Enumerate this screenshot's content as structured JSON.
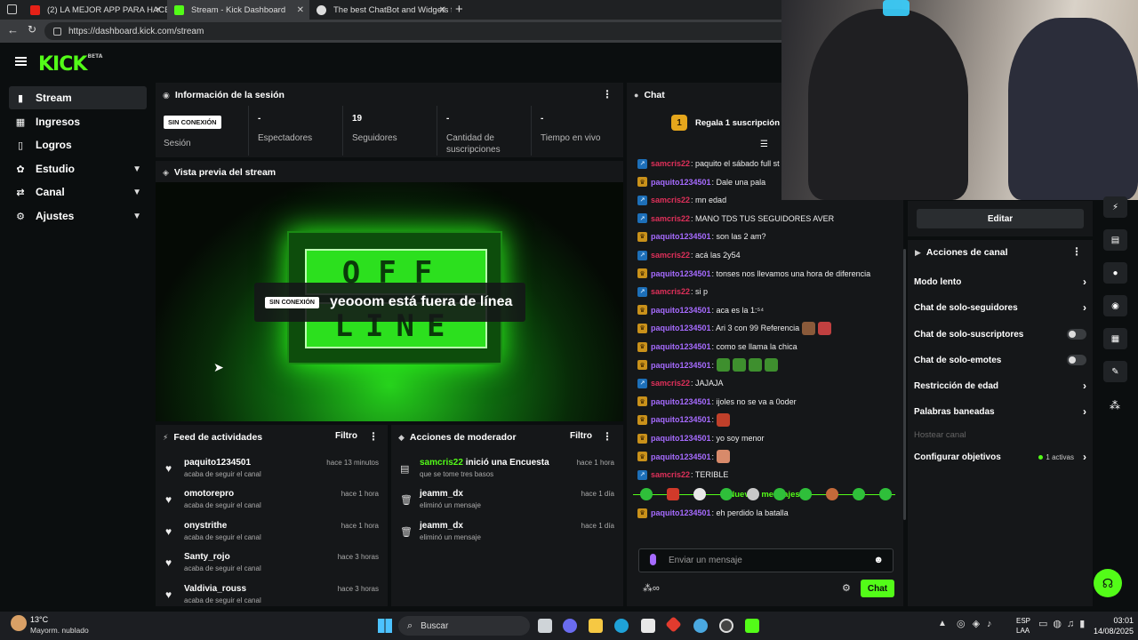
{
  "browser": {
    "tabs": [
      {
        "title": "(2) LA MEJOR APP PARA HACER I",
        "icon": "youtube-icon"
      },
      {
        "title": "Stream - Kick Dashboard",
        "icon": "kick-icon"
      },
      {
        "title": "The best ChatBot and Widgets fo",
        "icon": "botrix-icon"
      }
    ],
    "url": "https://dashboard.kick.com/stream"
  },
  "brand": {
    "logo": "KICK",
    "beta": "BETA",
    "accent": "#53fc18"
  },
  "sidebar": {
    "items": [
      {
        "label": "Stream",
        "icon": "stream-icon"
      },
      {
        "label": "Ingresos",
        "icon": "chart-icon"
      },
      {
        "label": "Logros",
        "icon": "trophy-icon"
      },
      {
        "label": "Estudio",
        "icon": "palette-icon"
      },
      {
        "label": "Canal",
        "icon": "channel-icon"
      },
      {
        "label": "Ajustes",
        "icon": "gear-icon"
      }
    ]
  },
  "session": {
    "title": "Información de la sesión",
    "badge": "SIN CONEXIÓN",
    "session_label": "Sesión",
    "stats": [
      {
        "value": "-",
        "label": "Espectadores"
      },
      {
        "value": "19",
        "label": "Seguidores"
      },
      {
        "value": "-",
        "label": "Cantidad de suscripciones"
      },
      {
        "value": "-",
        "label": "Tiempo en vivo"
      }
    ]
  },
  "preview": {
    "title": "Vista previa del stream",
    "badge": "SIN CONEXIÓN",
    "message": "yeooom está fuera de línea",
    "sign_top": "OFF",
    "sign_bottom": "LINE"
  },
  "feed": {
    "title": "Feed de actividades",
    "filter": "Filtro",
    "items": [
      {
        "name": "paquito1234501",
        "sub": "acaba de seguir el canal",
        "time": "hace 13 minutos"
      },
      {
        "name": "omotorepro",
        "sub": "acaba de seguir el canal",
        "time": "hace 1 hora"
      },
      {
        "name": "onystrithe",
        "sub": "acaba de seguir el canal",
        "time": "hace 1 hora"
      },
      {
        "name": "Santy_rojo",
        "sub": "acaba de seguir el canal",
        "time": "hace 3 horas"
      },
      {
        "name": "Valdivia_rouss",
        "sub": "acaba de seguir el canal",
        "time": "hace 3 horas"
      }
    ]
  },
  "mod": {
    "title": "Acciones de moderador",
    "filter": "Filtro",
    "items": [
      {
        "user": "samcris22",
        "action": " inició una Encuesta",
        "sub": "que se tome tres basos",
        "time": "hace 1 hora",
        "icon": "poll-icon"
      },
      {
        "user": "jeamm_dx",
        "action": "",
        "sub": "eliminó un mensaje",
        "time": "hace 1 día",
        "icon": "trash-icon"
      },
      {
        "user": "jeamm_dx",
        "action": "",
        "sub": "eliminó un mensaje",
        "time": "hace 1 día",
        "icon": "trash-icon"
      }
    ]
  },
  "chat": {
    "title": "Chat",
    "pinned": "Regala 1 suscripción pa",
    "pinned_num": "1",
    "new_messages": "Nuevos mensajes",
    "placeholder": "Enviar un mensaje",
    "send": "Chat",
    "messages": [
      {
        "user": "samcris22",
        "text": ": paquito el sábado full st",
        "badge": "blue"
      },
      {
        "user": "paquito1234501",
        "text": ": Dale una pala",
        "badge": "gold"
      },
      {
        "user": "samcris22",
        "text": ": mn edad",
        "badge": "blue"
      },
      {
        "user": "samcris22",
        "text": ": MANO TDS TUS SEGUIDORES AVER",
        "badge": "blue"
      },
      {
        "user": "paquito1234501",
        "text": ": son las 2 am?",
        "badge": "gold"
      },
      {
        "user": "samcris22",
        "text": ": acá las 2y54",
        "badge": "blue"
      },
      {
        "user": "paquito1234501",
        "text": ": tonses nos llevamos una hora de diferencia",
        "badge": "gold"
      },
      {
        "user": "samcris22",
        "text": ": si p",
        "badge": "blue"
      },
      {
        "user": "paquito1234501",
        "text": ": aca es la 1:⁵⁴",
        "badge": "gold"
      },
      {
        "user": "paquito1234501",
        "text": ": Ari 3 con 99 Referencia",
        "badge": "gold"
      },
      {
        "user": "paquito1234501",
        "text": ": como se llama la chica",
        "badge": "gold"
      },
      {
        "user": "paquito1234501",
        "text": ":",
        "badge": "gold"
      },
      {
        "user": "samcris22",
        "text": ": JAJAJA",
        "badge": "blue"
      },
      {
        "user": "paquito1234501",
        "text": ": ijoles no se va a 0oder",
        "badge": "gold"
      },
      {
        "user": "paquito1234501",
        "text": ":",
        "badge": "gold"
      },
      {
        "user": "paquito1234501",
        "text": ": yo soy menor",
        "badge": "gold"
      },
      {
        "user": "paquito1234501",
        "text": ":",
        "badge": "gold"
      },
      {
        "user": "samcris22",
        "text": ": TERIBLE",
        "badge": "blue"
      }
    ],
    "after": {
      "user": "paquito1234501",
      "text": ": eh perdido la batalla"
    }
  },
  "channel_actions": {
    "edit": "Editar",
    "title": "Acciones de canal",
    "rows": [
      {
        "label": "Modo lento",
        "control": "arrow"
      },
      {
        "label": "Chat de solo-seguidores",
        "control": "arrow"
      },
      {
        "label": "Chat de solo-suscriptores",
        "control": "toggle"
      },
      {
        "label": "Chat de solo-emotes",
        "control": "toggle"
      },
      {
        "label": "Restricción de edad",
        "control": "arrow"
      },
      {
        "label": "Palabras baneadas",
        "control": "arrow"
      },
      {
        "label": "Hostear canal",
        "control": "none"
      },
      {
        "label": "Configurar objetivos",
        "control": "arrow"
      }
    ],
    "objectives": "1 activas"
  },
  "taskbar": {
    "weather_temp": "13°C",
    "weather_desc": "Mayorm. nublado",
    "search": "Buscar",
    "lang_top": "ESP",
    "lang_bottom": "LAA",
    "time": "03:01",
    "date": "14/08/2025"
  }
}
